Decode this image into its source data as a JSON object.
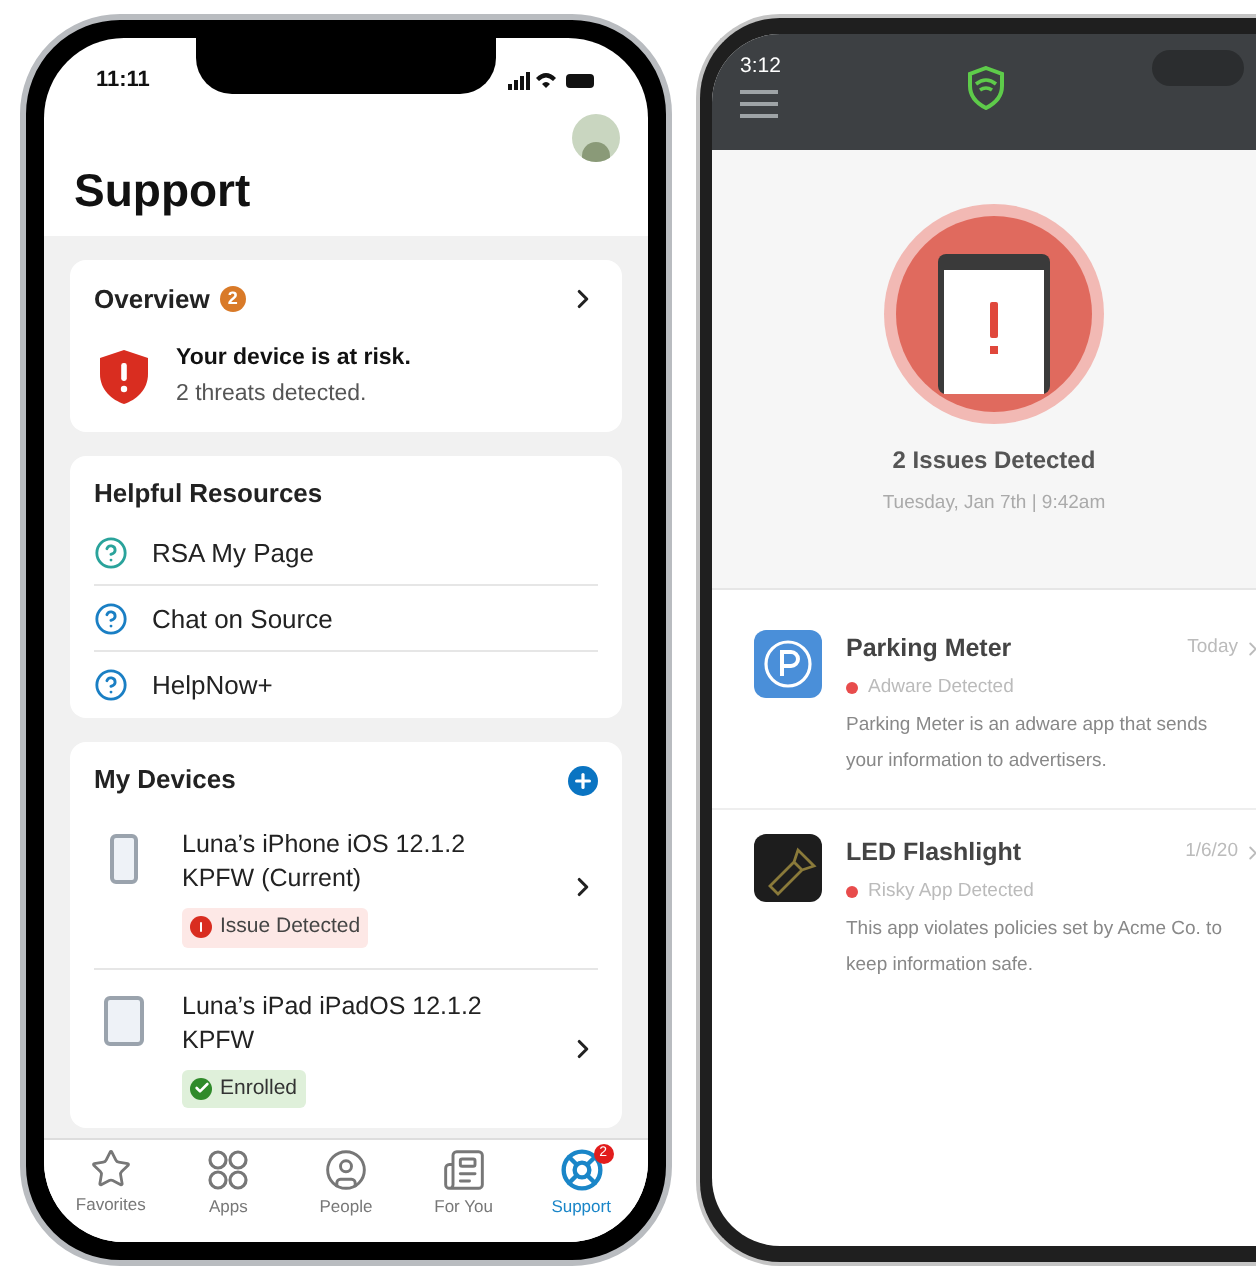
{
  "left_phone": {
    "status_time": "11:11",
    "title": "Support",
    "overview": {
      "title": "Overview",
      "badge": "2",
      "alert_title": "Your device is at risk.",
      "alert_subtitle": "2 threats detected."
    },
    "resources": {
      "title": "Helpful Resources",
      "items": [
        {
          "label": "RSA My Page"
        },
        {
          "label": "Chat on Source"
        },
        {
          "label": "HelpNow+"
        }
      ]
    },
    "devices": {
      "title": "My Devices",
      "items": [
        {
          "name": "Luna’s iPhone iOS 12.1.2 KPFW (Current)",
          "kind": "phone",
          "status": {
            "kind": "issue",
            "label": "Issue Detected"
          }
        },
        {
          "name": "Luna’s iPad iPadOS 12.1.2 KPFW",
          "kind": "tablet",
          "status": {
            "kind": "enrolled",
            "label": "Enrolled"
          }
        }
      ]
    },
    "tab_bar": [
      {
        "label": "Favorites",
        "selected": false
      },
      {
        "label": "Apps",
        "selected": false
      },
      {
        "label": "People",
        "selected": false
      },
      {
        "label": "For You",
        "selected": false
      },
      {
        "label": "Support",
        "selected": true,
        "badge": "2"
      }
    ]
  },
  "right_phone": {
    "status_time": "3:12",
    "summary": {
      "title": "2 Issues Detected",
      "date": "Tuesday, Jan 7th | 9:42am"
    },
    "issues": [
      {
        "kind": "parking",
        "name": "Parking Meter",
        "date": "Today",
        "type": "Adware Detected",
        "description": "Parking Meter is an adware app that sends your information to advertisers."
      },
      {
        "kind": "flashlight",
        "name": "LED Flashlight",
        "date": "1/6/20",
        "type": "Risky App Detected",
        "description": "This app violates policies set by Acme Co. to keep information safe."
      }
    ]
  }
}
